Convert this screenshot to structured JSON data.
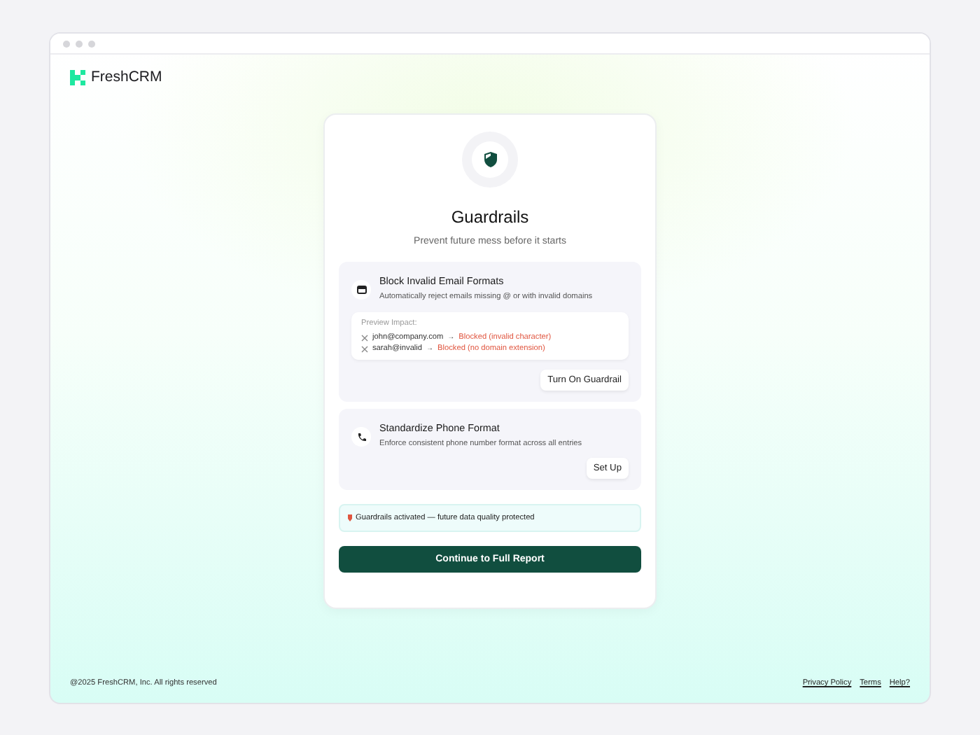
{
  "brand": {
    "name": "FreshCRM"
  },
  "card": {
    "title": "Guardrails",
    "subtitle": "Prevent future mess before it starts"
  },
  "guardrails": [
    {
      "kind": "email",
      "title": "Block Invalid Email Formats",
      "description": "Automatically reject emails missing @ or with invalid domains",
      "preview": {
        "label": "Preview Impact:",
        "rows": [
          {
            "input": "john@company.com",
            "arrow": "→",
            "result": "Blocked (invalid character)"
          },
          {
            "input": "sarah@invalid",
            "arrow": "→",
            "result": "Blocked (no domain extension)"
          }
        ]
      },
      "button": "Turn On Guardrail"
    },
    {
      "kind": "phone",
      "title": "Standardize Phone Format",
      "description": "Enforce consistent phone number format across all entries",
      "button": "Set Up"
    }
  ],
  "notice": {
    "text": "Guardrails activated — future data quality protected"
  },
  "primary_button": "Continue to Full Report",
  "footer": {
    "copyright": "@2025 FreshCRM, Inc. All rights reserved",
    "links": [
      "Privacy Policy",
      "Terms",
      "Help?"
    ]
  }
}
